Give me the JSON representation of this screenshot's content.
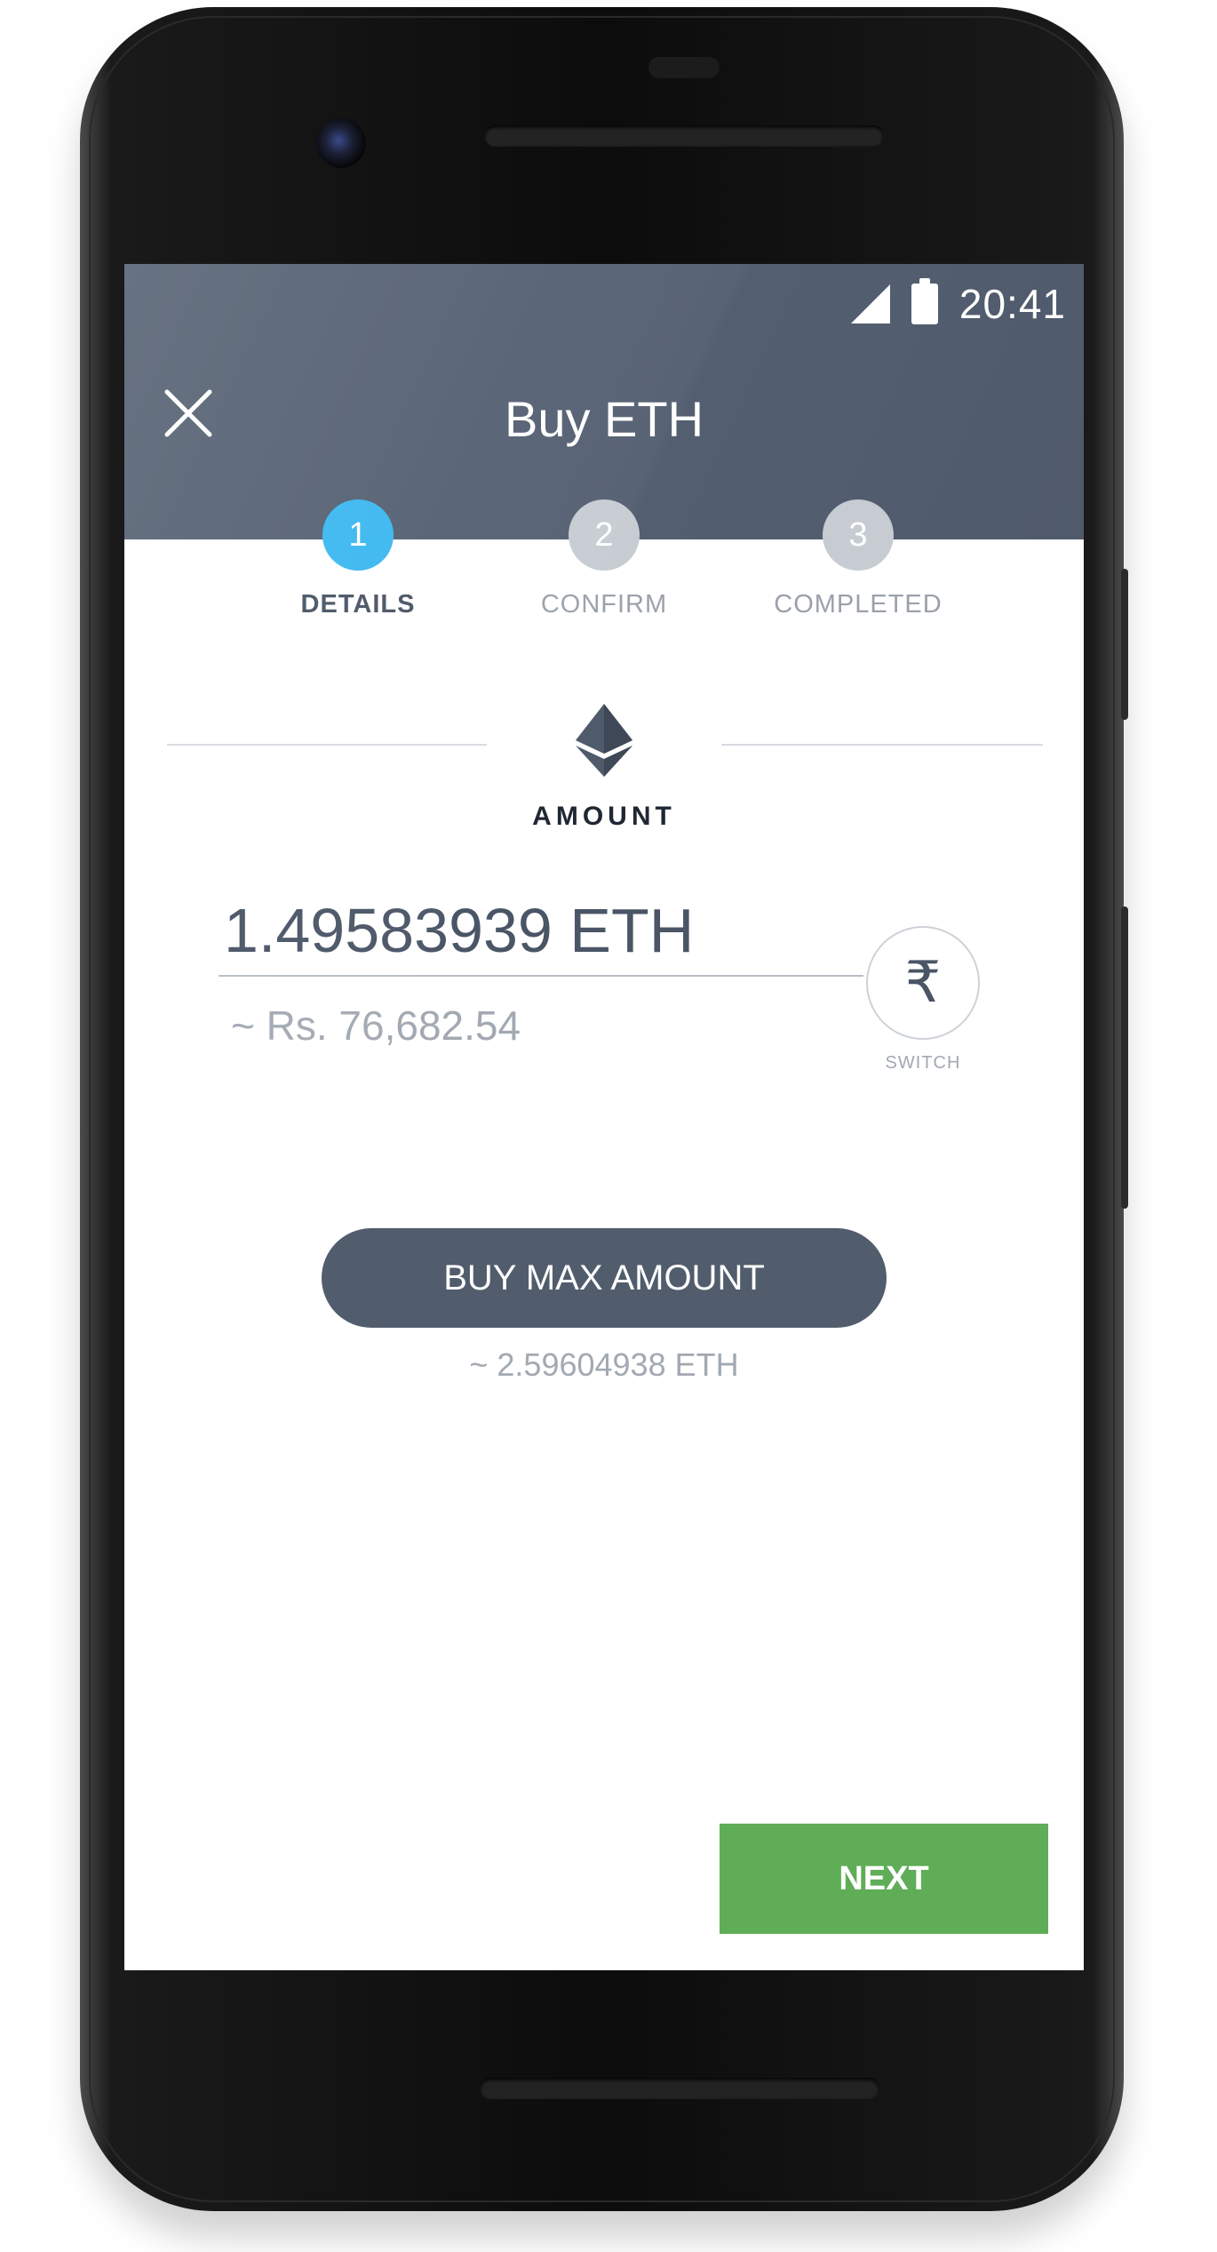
{
  "status_bar": {
    "time": "20:41",
    "icons": [
      "signal-icon",
      "battery-icon"
    ]
  },
  "header": {
    "title": "Buy ETH",
    "close_icon": "close-icon"
  },
  "stepper": {
    "steps": [
      {
        "number": "1",
        "label": "DETAILS",
        "state": "active"
      },
      {
        "number": "2",
        "label": "CONFIRM",
        "state": "inactive"
      },
      {
        "number": "3",
        "label": "COMPLETED",
        "state": "inactive"
      }
    ]
  },
  "amount_section": {
    "icon": "ethereum-icon",
    "label": "AMOUNT",
    "value": "1.49583939 ETH",
    "fiat_equivalent": "~ Rs. 76,682.54"
  },
  "switch": {
    "icon": "rupee-icon",
    "symbol": "₹",
    "label": "SWITCH"
  },
  "buy_max": {
    "label": "BUY MAX AMOUNT",
    "max_note": "~ 2.59604938 ETH"
  },
  "footer": {
    "next_label": "NEXT"
  },
  "colors": {
    "header": "#556173",
    "active_step": "#3db8f0",
    "inactive_step": "#c6ccd2",
    "buy_max_button": "#515c6c",
    "next_button": "#5fad57"
  }
}
